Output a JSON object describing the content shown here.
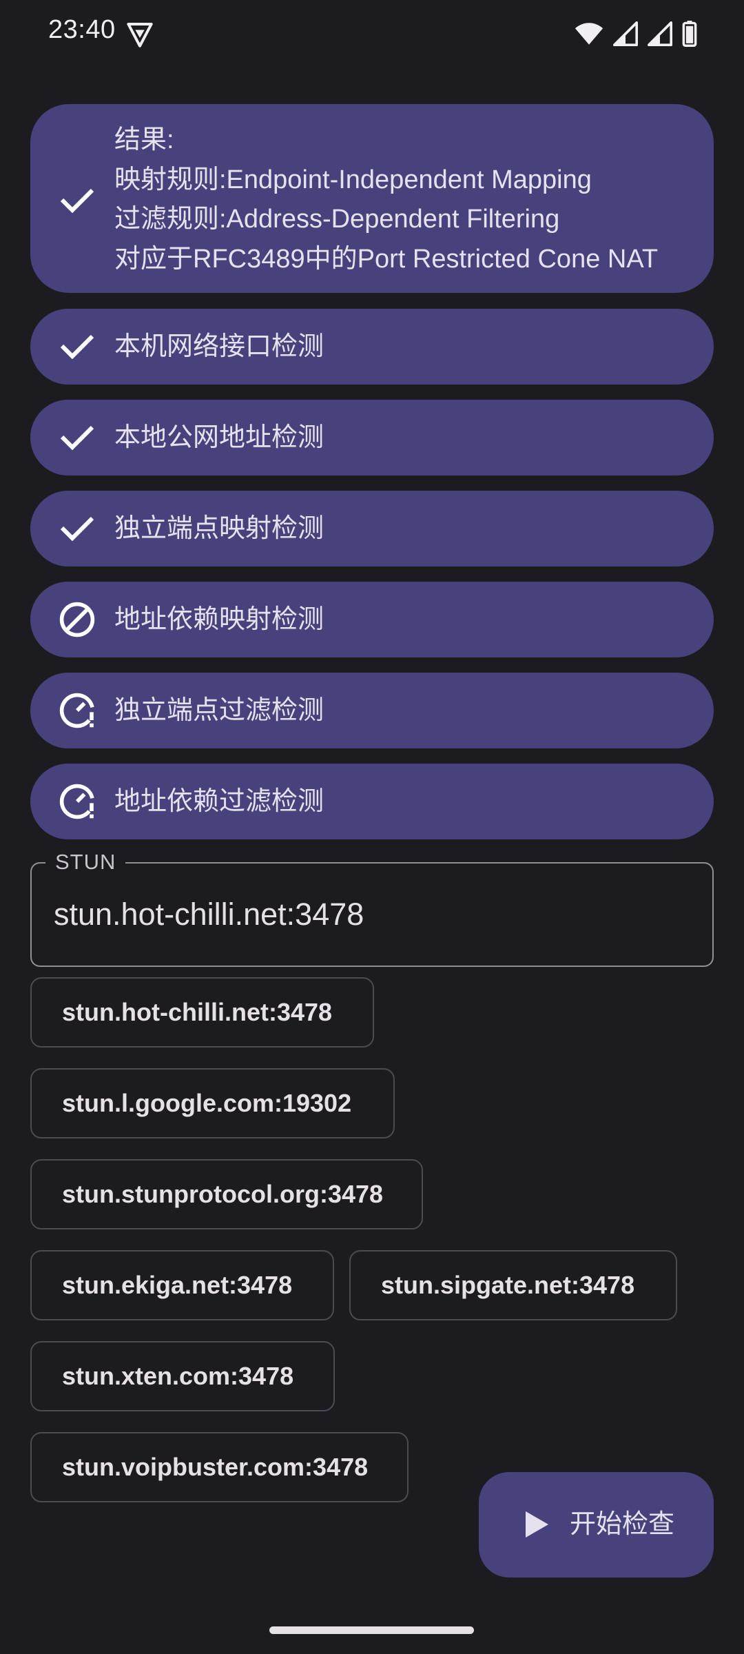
{
  "status_bar": {
    "time": "23:40"
  },
  "result": {
    "icon": "check-icon",
    "lines": [
      "结果:",
      "映射规则:Endpoint-Independent Mapping",
      "过滤规则:Address-Dependent Filtering",
      "对应于RFC3489中的Port Restricted Cone NAT"
    ]
  },
  "steps": [
    {
      "label": "本机网络接口检测",
      "status": "done",
      "icon": "check-icon"
    },
    {
      "label": "本地公网地址检测",
      "status": "done",
      "icon": "check-icon"
    },
    {
      "label": "独立端点映射检测",
      "status": "done",
      "icon": "check-icon"
    },
    {
      "label": "地址依赖映射检测",
      "status": "skipped",
      "icon": "block-icon"
    },
    {
      "label": "独立端点过滤检测",
      "status": "warning",
      "icon": "timer-alert-icon"
    },
    {
      "label": "地址依赖过滤检测",
      "status": "warning",
      "icon": "timer-alert-icon"
    }
  ],
  "stun_field": {
    "label": "STUN",
    "value": "stun.hot-chilli.net:3478"
  },
  "servers": [
    "stun.hot-chilli.net:3478",
    "stun.l.google.com:19302",
    "stun.stunprotocol.org:3478",
    "stun.ekiga.net:3478",
    "stun.sipgate.net:3478",
    "stun.xten.com:3478",
    "stun.voipbuster.com:3478"
  ],
  "fab": {
    "label": "开始检查",
    "icon": "play-icon"
  },
  "colors": {
    "background": "#1c1b20",
    "card": "#48427c",
    "outline": "#938f99"
  }
}
